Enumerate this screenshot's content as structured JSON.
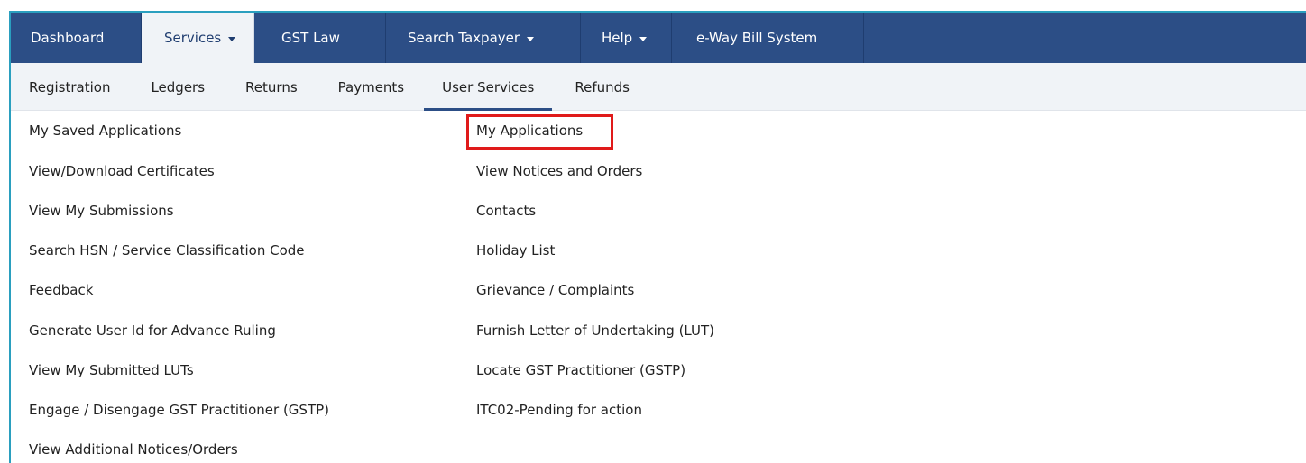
{
  "top_nav": {
    "tabs": [
      {
        "label": "Dashboard",
        "has_caret": false
      },
      {
        "label": "Services",
        "has_caret": true,
        "active": true
      },
      {
        "label": "GST Law",
        "has_caret": false
      },
      {
        "label": "Search Taxpayer",
        "has_caret": true
      },
      {
        "label": "Help",
        "has_caret": true
      },
      {
        "label": "e-Way Bill System",
        "has_caret": false
      }
    ]
  },
  "sub_nav": {
    "tabs": [
      {
        "label": "Registration"
      },
      {
        "label": "Ledgers"
      },
      {
        "label": "Returns"
      },
      {
        "label": "Payments"
      },
      {
        "label": "User Services",
        "active": true
      },
      {
        "label": "Refunds"
      }
    ]
  },
  "menu": {
    "left_column": [
      "My Saved Applications",
      "View/Download Certificates",
      "View My Submissions",
      "Search HSN / Service Classification Code",
      "Feedback",
      "Generate User Id for Advance Ruling",
      "View My Submitted LUTs",
      "Engage / Disengage GST Practitioner (GSTP)",
      "View Additional Notices/Orders"
    ],
    "right_column": [
      "My Applications",
      "View Notices and Orders",
      "Contacts",
      "Holiday List",
      "Grievance / Complaints",
      "Furnish Letter of Undertaking (LUT)",
      "Locate GST Practitioner (GSTP)",
      "ITC02-Pending for action"
    ],
    "highlighted_item": "My Applications"
  },
  "colors": {
    "nav_bg": "#2c4e86",
    "subnav_bg": "#f0f3f7",
    "highlight": "#e01a1a",
    "frame": "#2a9fbf"
  }
}
